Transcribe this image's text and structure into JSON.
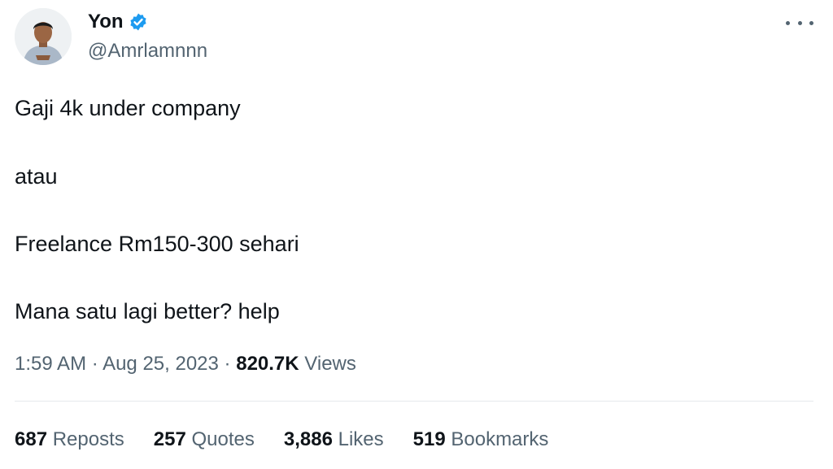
{
  "author": {
    "display_name": "Yon",
    "handle": "@Amrlamnnn",
    "verified": true,
    "verified_icon": "verified-badge-icon",
    "accent_color": "#1d9bf0"
  },
  "tweet": {
    "lines": [
      "Gaji 4k under company",
      "atau",
      "Freelance Rm150-300 sehari",
      "Mana satu lagi better? help"
    ],
    "time": "1:59 AM",
    "separator": "·",
    "date": "Aug 25, 2023",
    "views_count": "820.7K",
    "views_label": "Views"
  },
  "stats": [
    {
      "count": "687",
      "label": "Reposts"
    },
    {
      "count": "257",
      "label": "Quotes"
    },
    {
      "count": "3,886",
      "label": "Likes"
    },
    {
      "count": "519",
      "label": "Bookmarks"
    }
  ],
  "more_icon": "more-options-icon"
}
